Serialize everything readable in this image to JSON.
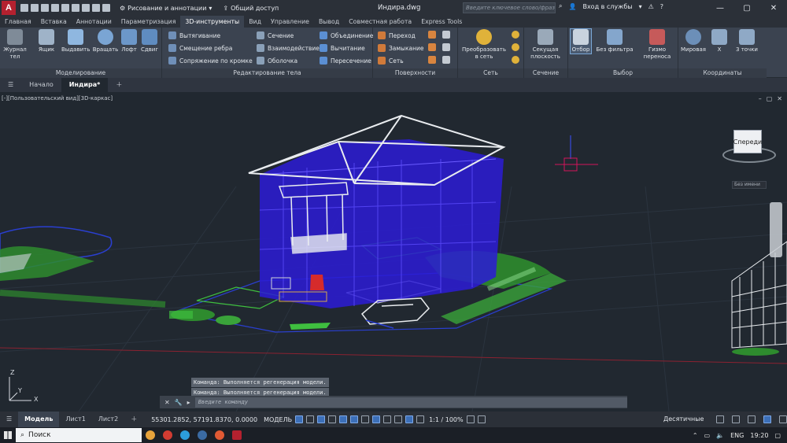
{
  "app": {
    "logo": "A",
    "title": "Индира.dwg",
    "workspace": "Рисование и аннотации",
    "share": "Общий доступ",
    "search_placeholder": "Введите ключевое слово/фразу",
    "login": "Вход в службы"
  },
  "ribbon_tabs": [
    "Главная",
    "Вставка",
    "Аннотации",
    "Параметризация",
    "3D-инструменты",
    "Вид",
    "Управление",
    "Вывод",
    "Совместная работа",
    "Express Tools"
  ],
  "active_tab": "3D-инструменты",
  "ribbon": {
    "modeling": {
      "title": "Моделирование",
      "buttons": [
        "Журнал тел",
        "Ящик",
        "Выдавить",
        "Вращать",
        "Лофт",
        "Сдвиг"
      ]
    },
    "solid_edit": {
      "title": "Редактирование тела",
      "col1": [
        "Вытягивание",
        "Смещение ребра",
        "Сопряжение по кромке"
      ],
      "col2": [
        "Сечение",
        "Взаимодействие",
        "Оболочка"
      ],
      "col3": [
        "Объединение",
        "Вычитание",
        "Пересечение"
      ]
    },
    "surfaces": {
      "title": "Поверхности",
      "items": [
        "Переход",
        "Замыкание",
        "Сеть"
      ]
    },
    "mesh": {
      "title": "Сеть",
      "button": "Преобразовать в сеть"
    },
    "section": {
      "title": "Сечение",
      "button": "Секущая плоскость"
    },
    "selection": {
      "title": "Выбор",
      "buttons": [
        "Отбор",
        "Без фильтра",
        "Гизмо переноса"
      ]
    },
    "coords": {
      "title": "Координаты",
      "buttons": [
        "Мировая",
        "X",
        "3 точки"
      ]
    }
  },
  "file_tabs": [
    "Начало",
    "Индира*"
  ],
  "viewport": {
    "label": "[-][Пользовательский вид][3D-каркас]",
    "viewcube_face": "Спереди",
    "ucs_button": "Без имени",
    "axis_labels": [
      "Z",
      "Y",
      "X"
    ]
  },
  "command": {
    "history": [
      "Команда:  Выполняется регенерация модели.",
      "Команда:  Выполняется регенерация модели."
    ],
    "placeholder": "Введите команду"
  },
  "status": {
    "tabs": [
      "Модель",
      "Лист1",
      "Лист2"
    ],
    "coords": "55301.2852, 57191.8370, 0.0000",
    "mode": "МОДЕЛЬ",
    "scale": "1:1 / 100%",
    "units": "Десятичные"
  },
  "taskbar": {
    "search": "Поиск",
    "lang": "ENG",
    "time": "19:20"
  },
  "colors": {
    "accent": "#3c6fb8",
    "blue_house": "#2b1bd6",
    "grass": "#2e8b2e"
  }
}
